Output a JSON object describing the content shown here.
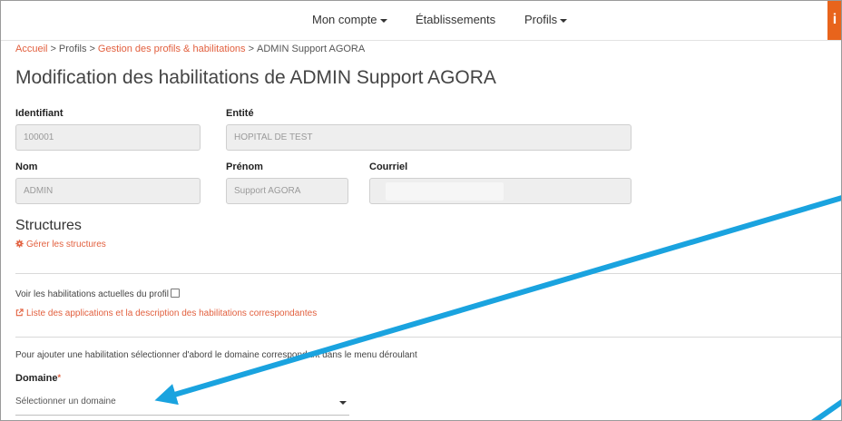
{
  "nav": {
    "account_label": "Mon compte",
    "establishments_label": "Établissements",
    "profiles_label": "Profils",
    "info_label": "i"
  },
  "breadcrumb": {
    "home": "Accueil",
    "profiles": "Profils",
    "management": "Gestion des profils & habilitations",
    "current": "ADMIN Support AGORA"
  },
  "page": {
    "title": "Modification des habilitations de ADMIN Support AGORA"
  },
  "form": {
    "identifiant": {
      "label": "Identifiant",
      "value": "100001"
    },
    "entite": {
      "label": "Entité",
      "value": "HOPITAL DE TEST"
    },
    "nom": {
      "label": "Nom",
      "value": "ADMIN"
    },
    "prenom": {
      "label": "Prénom",
      "value": "Support AGORA"
    },
    "courriel": {
      "label": "Courriel",
      "value": ""
    }
  },
  "structures": {
    "title": "Structures",
    "manage_link": "Gérer les structures"
  },
  "habilitations": {
    "show_current_label": "Voir les habilitations actuelles du profil",
    "apps_link": "Liste des applications et la description des habilitations correspondantes",
    "instruction": "Pour ajouter une habilitation sélectionner d'abord le domaine correspondant dans le menu déroulant",
    "domain_label": "Domaine",
    "required_mark": "*",
    "domain_placeholder": "Sélectionner un domaine"
  },
  "colors": {
    "accent": "#e2603f",
    "info_tab": "#e8641c",
    "annotation_arrow": "#1aa3df"
  }
}
